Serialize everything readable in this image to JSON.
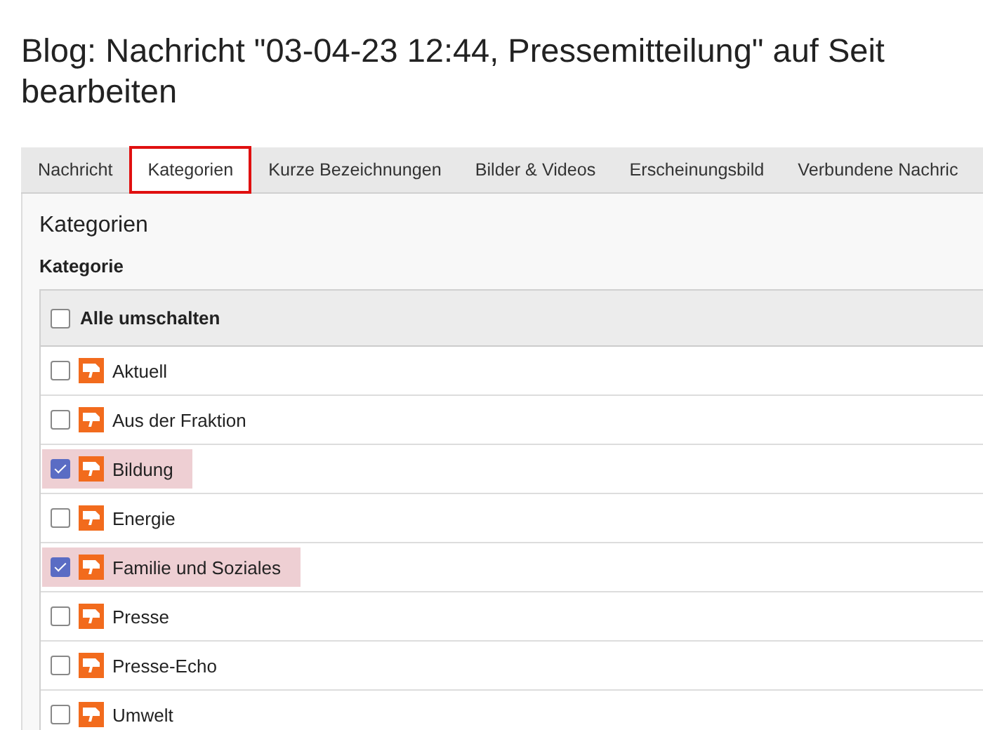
{
  "page_title": {
    "lines": [
      "Blog: Nachricht \"03-04-23 12:44, Pressemitteilung\" auf Seit",
      "bearbeiten"
    ]
  },
  "tabs": [
    {
      "label": "Nachricht",
      "selected": false
    },
    {
      "label": "Kategorien",
      "selected": true
    },
    {
      "label": "Kurze Bezeichnungen",
      "selected": false
    },
    {
      "label": "Bilder & Videos",
      "selected": false
    },
    {
      "label": "Erscheinungsbild",
      "selected": false
    },
    {
      "label": "Verbundene Nachric",
      "selected": false
    }
  ],
  "panel": {
    "heading": "Kategorien",
    "field_label": "Kategorie",
    "toggle_all": {
      "label": "Alle umschalten",
      "checked": false
    },
    "categories": [
      {
        "label": "Aktuell",
        "checked": false
      },
      {
        "label": "Aus der Fraktion",
        "checked": false
      },
      {
        "label": "Bildung",
        "checked": true
      },
      {
        "label": "Energie",
        "checked": false
      },
      {
        "label": "Familie und Soziales",
        "checked": true
      },
      {
        "label": "Presse",
        "checked": false
      },
      {
        "label": "Presse-Echo",
        "checked": false
      },
      {
        "label": "Umwelt",
        "checked": false
      }
    ]
  }
}
